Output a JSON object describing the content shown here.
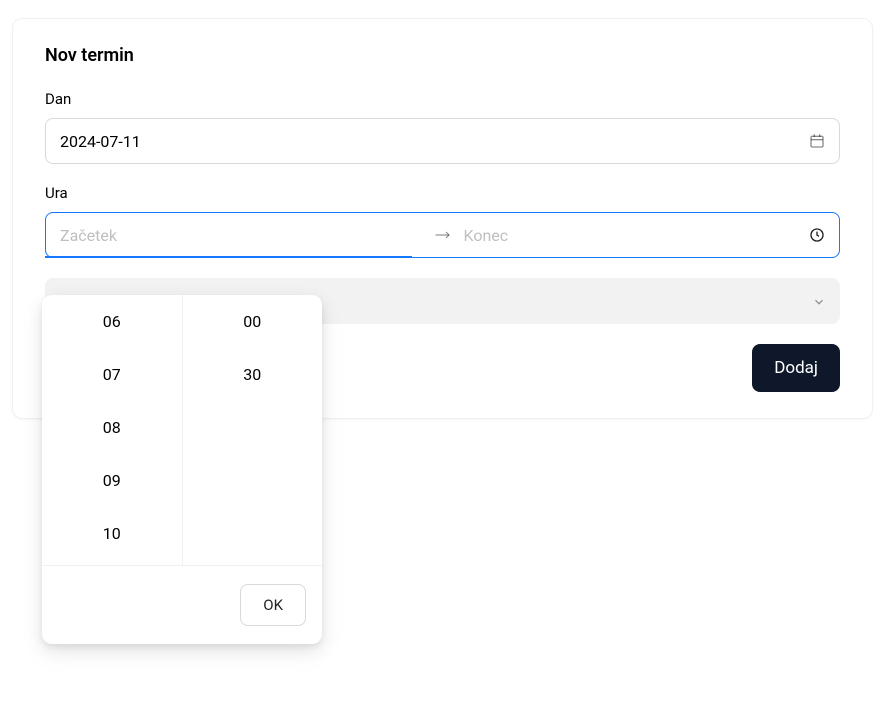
{
  "card": {
    "title": "Nov termin"
  },
  "form": {
    "date": {
      "label": "Dan",
      "value": "2024-07-11"
    },
    "time": {
      "label": "Ura",
      "start_placeholder": "Začetek",
      "end_placeholder": "Konec"
    },
    "submit_label": "Dodaj"
  },
  "time_picker": {
    "hours": [
      "06",
      "07",
      "08",
      "09",
      "10"
    ],
    "minutes": [
      "00",
      "30"
    ],
    "ok_label": "OK"
  }
}
